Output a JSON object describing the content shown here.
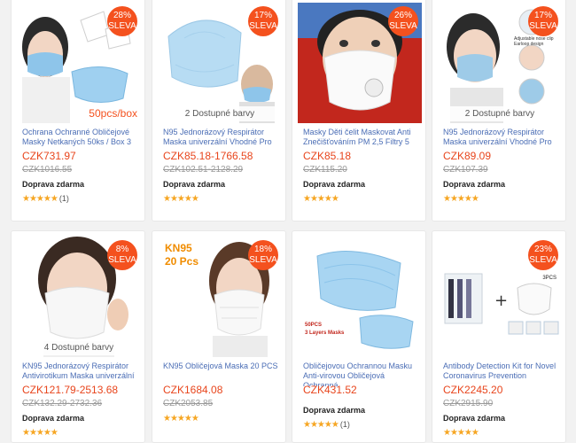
{
  "products": [
    {
      "discount_pct": "28%",
      "discount_word": "SLEVA",
      "title": "Ochrana Ochranné Obličejové Masky Netkaných 50ks / Box 3",
      "price": "CZK731.97",
      "old_price": "CZK1016.55",
      "shipping": "Doprava zdarma",
      "stars": "★★★★★",
      "reviews": "(1)",
      "image_text": "50pcs/box",
      "variants": ""
    },
    {
      "discount_pct": "17%",
      "discount_word": "SLEVA",
      "title": "N95 Jednorázový Respirátor Maska univerzální Vhodné Pro",
      "price": "CZK85.18-1766.58",
      "old_price": "CZK102.51-2128.29",
      "shipping": "Doprava zdarma",
      "stars": "★★★★★",
      "reviews": "",
      "image_text": "",
      "variants": "2 Dostupné barvy"
    },
    {
      "discount_pct": "26%",
      "discount_word": "SLEVA",
      "title": "Masky Děti čelit Maskovat Anti Znečišťováním PM 2,5 Filtry 5",
      "price": "CZK85.18",
      "old_price": "CZK115.20",
      "shipping": "Doprava zdarma",
      "stars": "★★★★★",
      "reviews": "",
      "image_text": "",
      "variants": ""
    },
    {
      "discount_pct": "17%",
      "discount_word": "SLEVA",
      "title": "N95 Jednorázový Respirátor Maska univerzální Vhodné Pro",
      "price": "CZK89.09",
      "old_price": "CZK107.39",
      "shipping": "Doprava zdarma",
      "stars": "★★★★★",
      "reviews": "",
      "image_text": "Adjustable nose clip|Earloop design",
      "variants": "2 Dostupné barvy"
    },
    {
      "discount_pct": "8%",
      "discount_word": "SLEVA",
      "title": "KN95 Jednorázový Respirátor Antivirotikum Maska univerzální",
      "price": "CZK121.79-2513.68",
      "old_price": "CZK132.29-2732.36",
      "shipping": "Doprava zdarma",
      "stars": "★★★★★",
      "reviews": "",
      "image_text": "",
      "variants": "4 Dostupné barvy"
    },
    {
      "discount_pct": "18%",
      "discount_word": "SLEVA",
      "title": "KN95 Obličejová Maska 20 PCS",
      "price": "CZK1684.08",
      "old_price": "CZK2053.85",
      "shipping": "",
      "stars": "★★★★★",
      "reviews": "",
      "image_text": "KN95|20 Pcs",
      "variants": ""
    },
    {
      "discount_pct": "",
      "discount_word": "",
      "title": "Obličejovou Ochrannou Masku Anti-virovou Obličejová Ochranná",
      "price": "CZK431.52",
      "old_price": "",
      "shipping": "Doprava zdarma",
      "stars": "★★★★★",
      "reviews": "(1)",
      "image_text": "50PCS|3 Layers Masks",
      "variants": ""
    },
    {
      "discount_pct": "23%",
      "discount_word": "SLEVA",
      "title": "Antibody Detection Kit for Novel Coronavirus Prevention",
      "price": "CZK2245.20",
      "old_price": "CZK2915.90",
      "shipping": "Doprava zdarma",
      "stars": "★★★★★",
      "reviews": "",
      "image_text": "3PCS",
      "variants": ""
    }
  ],
  "colors": {
    "badge": "#f4511e",
    "price": "#e8451c",
    "title": "#4a6db5",
    "star": "#f6a623",
    "mask_blue": "#9ecbe8"
  }
}
